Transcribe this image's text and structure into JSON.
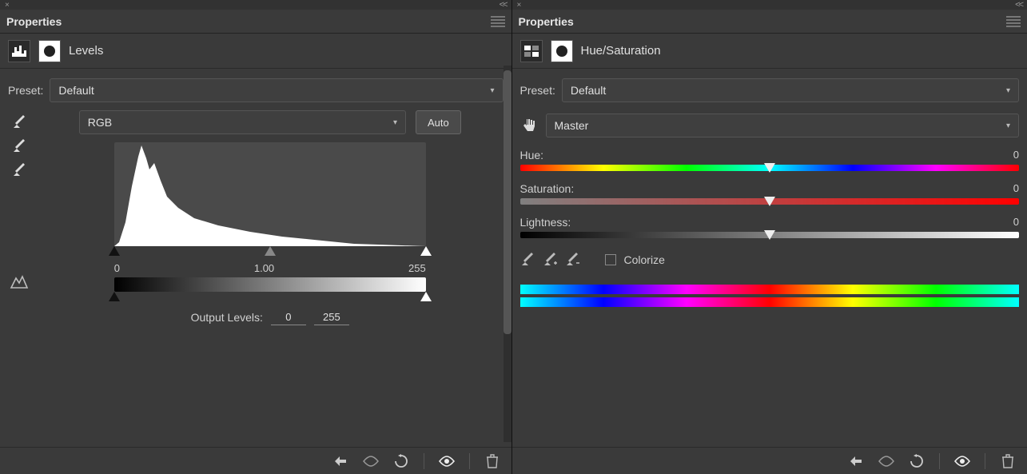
{
  "left": {
    "panel_title": "Properties",
    "adjustment_name": "Levels",
    "preset_label": "Preset:",
    "preset_value": "Default",
    "channel_value": "RGB",
    "auto_label": "Auto",
    "shadow_input": "0",
    "mid_input": "1.00",
    "highlight_input": "255",
    "output_label": "Output Levels:",
    "output_low": "0",
    "output_high": "255"
  },
  "right": {
    "panel_title": "Properties",
    "adjustment_name": "Hue/Saturation",
    "preset_label": "Preset:",
    "preset_value": "Default",
    "range_value": "Master",
    "hue_label": "Hue:",
    "hue_value": "0",
    "sat_label": "Saturation:",
    "sat_value": "0",
    "light_label": "Lightness:",
    "light_value": "0",
    "colorize_label": "Colorize"
  }
}
